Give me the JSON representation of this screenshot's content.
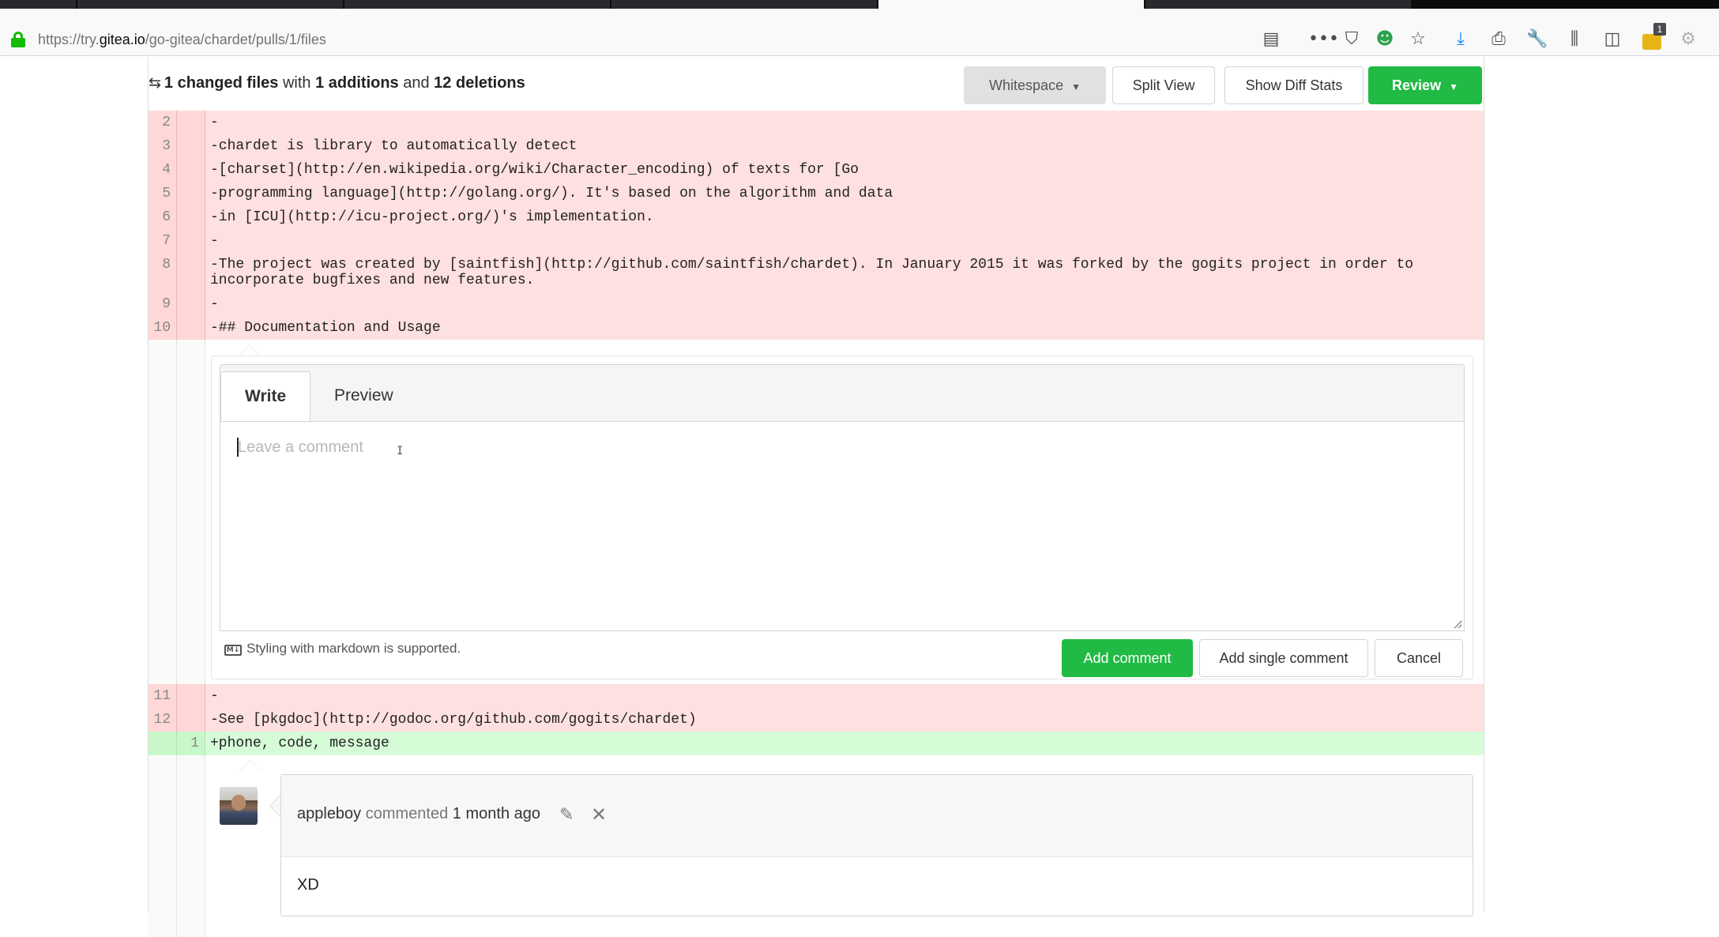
{
  "browser": {
    "url_prefix": "https://try.",
    "url_host": "gitea.io",
    "url_path": "/go-gitea/chardet/pulls/1/files",
    "toolbar_icons": [
      "reader-view-icon",
      "more-icon",
      "pocket-icon",
      "extension-icon",
      "bookmark-star-icon",
      "download-icon",
      "print-icon",
      "wrench-icon",
      "library-icon",
      "sidebar-icon",
      "notification-icon",
      "extension2-icon"
    ],
    "notification_count": "1"
  },
  "diffbar": {
    "changed_files": "1 changed files",
    "with": " with ",
    "additions": "1 additions",
    "and": " and ",
    "deletions": "12 deletions",
    "whitespace_label": "Whitespace",
    "split_view_label": "Split View",
    "diff_stats_label": "Show Diff Stats",
    "review_label": "Review"
  },
  "diff_lines_top": [
    {
      "old": "2",
      "new": "",
      "type": "del",
      "text": "-"
    },
    {
      "old": "3",
      "new": "",
      "type": "del",
      "text": "-chardet is library to automatically detect"
    },
    {
      "old": "4",
      "new": "",
      "type": "del",
      "text": "-[charset](http://en.wikipedia.org/wiki/Character_encoding) of texts for [Go"
    },
    {
      "old": "5",
      "new": "",
      "type": "del",
      "text": "-programming language](http://golang.org/). It's based on the algorithm and data"
    },
    {
      "old": "6",
      "new": "",
      "type": "del",
      "text": "-in [ICU](http://icu-project.org/)'s implementation."
    },
    {
      "old": "7",
      "new": "",
      "type": "del",
      "text": "-"
    },
    {
      "old": "8",
      "new": "",
      "type": "del",
      "text": "-The project was created by [saintfish](http://github.com/saintfish/chardet). In January 2015 it was forked by the gogits project in order to incorporate bugfixes and new features."
    },
    {
      "old": "9",
      "new": "",
      "type": "del",
      "text": "-"
    },
    {
      "old": "10",
      "new": "",
      "type": "del",
      "text": "-## Documentation and Usage"
    }
  ],
  "comment_form": {
    "tab_write": "Write",
    "tab_preview": "Preview",
    "placeholder": "Leave a comment",
    "markdown_note": "Styling with markdown is supported.",
    "markdown_icon": "M↓",
    "add_comment": "Add comment",
    "add_single_comment": "Add single comment",
    "cancel": "Cancel"
  },
  "diff_lines_bottom": [
    {
      "old": "11",
      "new": "",
      "type": "del",
      "text": "-"
    },
    {
      "old": "12",
      "new": "",
      "type": "del",
      "text": "-See [pkgdoc](http://godoc.org/github.com/gogits/chardet)"
    },
    {
      "old": "",
      "new": "1",
      "type": "add",
      "text": "+phone, code, message"
    }
  ],
  "comment": {
    "author": "appleboy",
    "action": " commented ",
    "time": "1 month ago",
    "body": "XD"
  }
}
